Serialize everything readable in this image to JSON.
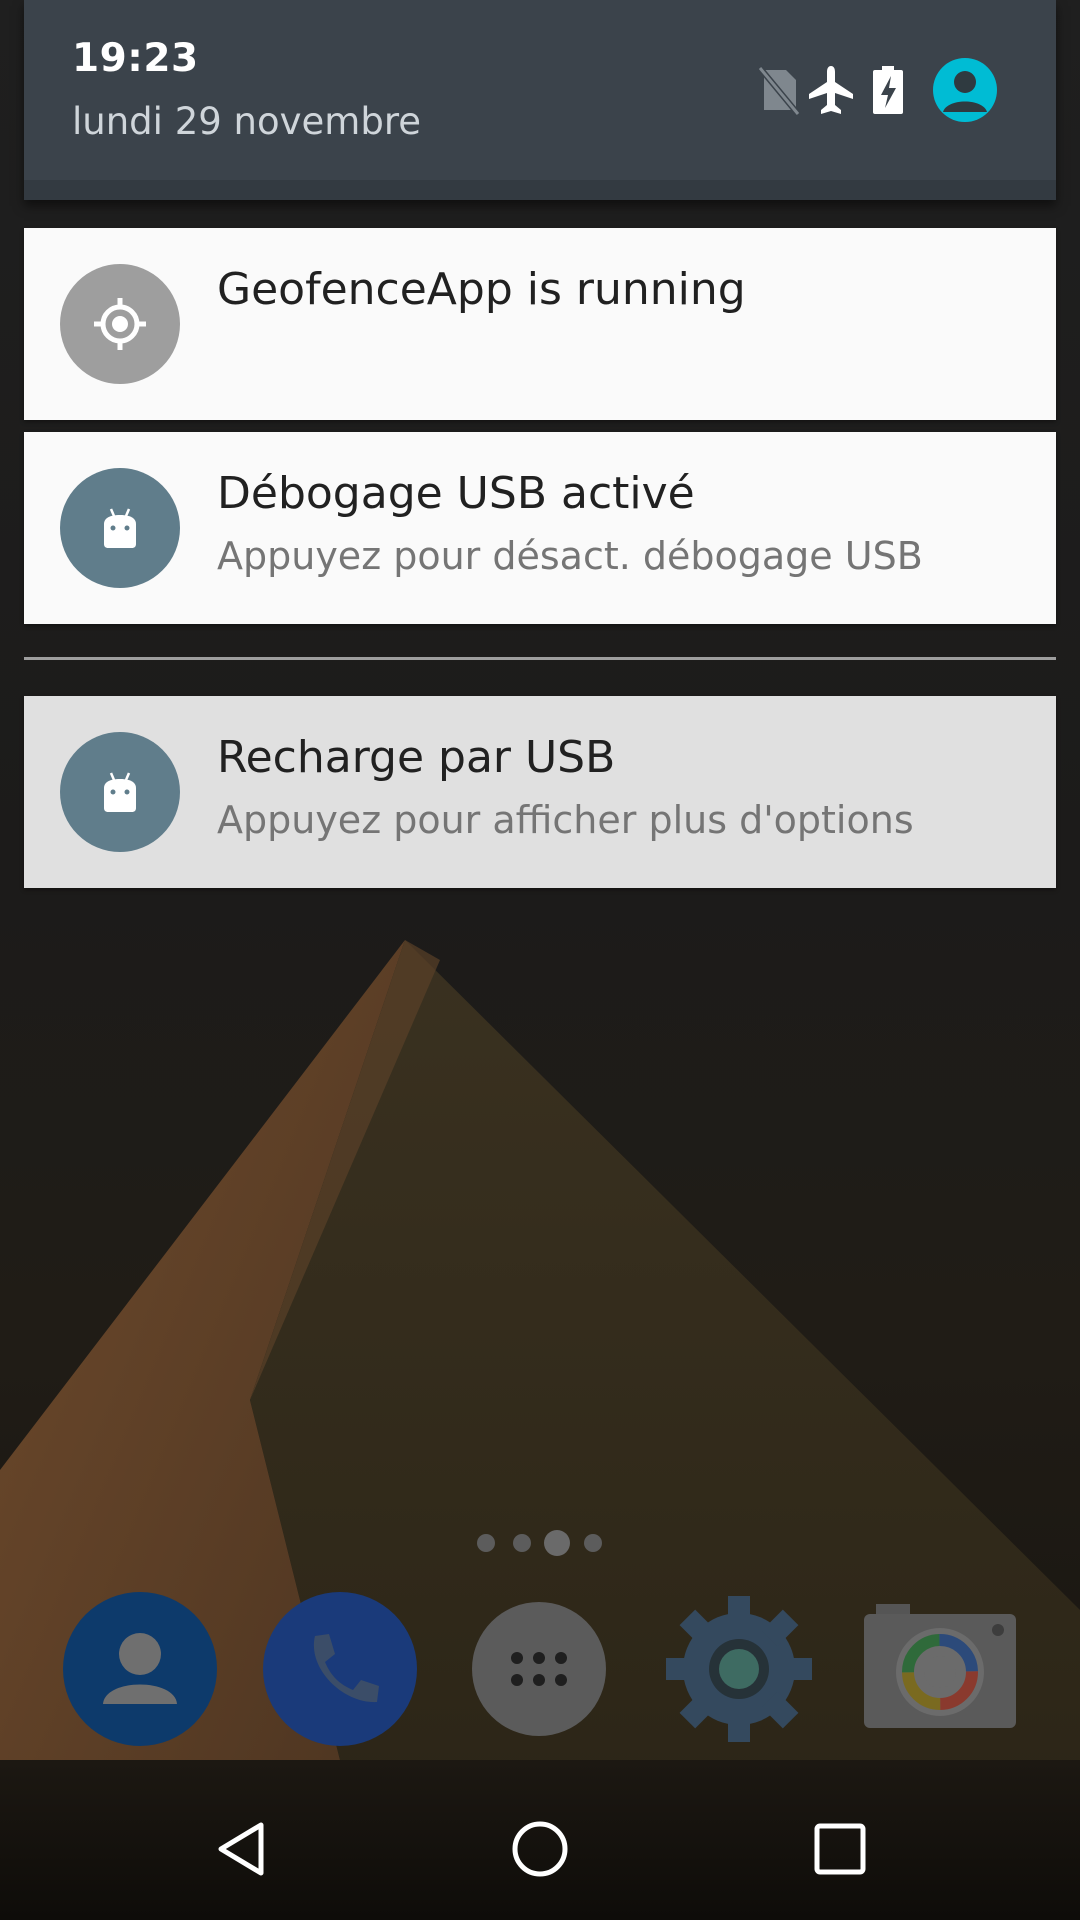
{
  "status": {
    "time": "19:23",
    "date": "lundi 29 novembre",
    "icons": [
      "no-sim-icon",
      "airplane-mode-icon",
      "battery-charging-icon",
      "user-avatar-icon"
    ]
  },
  "notifications": [
    {
      "app_icon": "location-target-icon",
      "title": "GeofenceApp is running",
      "text": ""
    },
    {
      "app_icon": "android-debug-icon",
      "title": "Débogage USB activé",
      "text": "Appuyez pour désact. débogage USB"
    },
    {
      "app_icon": "android-usb-icon",
      "title": "Recharge par USB",
      "text": "Appuyez pour afficher plus d'options"
    }
  ],
  "home": {
    "page_count": 4,
    "current_page": 3,
    "dock": [
      "contacts-icon",
      "phone-icon",
      "app-drawer-icon",
      "settings-icon",
      "camera-icon"
    ]
  },
  "navbar": [
    "back-button",
    "home-button",
    "recents-button"
  ],
  "colors": {
    "header_bg": "#3b434b",
    "avatar": "#00bcd4",
    "geofence_icon_bg": "#9e9e9e",
    "android_icon_bg": "#607d8b",
    "notification_bg": "#fafafa",
    "notification_dim_bg": "#e0e0e0"
  }
}
